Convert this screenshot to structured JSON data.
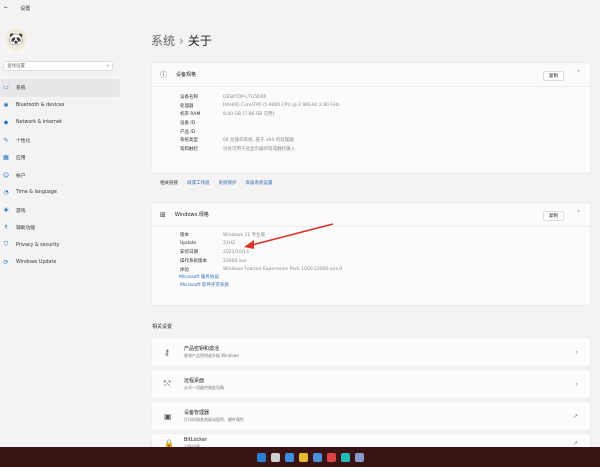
{
  "window": {
    "title": "设置",
    "back": "←"
  },
  "search": {
    "placeholder": "查找设置"
  },
  "sidebar": {
    "items": [
      {
        "label": "系统",
        "icon": "monitor-icon"
      },
      {
        "label": "Bluetooth & devices",
        "icon": "bluetooth-icon"
      },
      {
        "label": "Network & internet",
        "icon": "wifi-icon"
      },
      {
        "label": "个性化",
        "icon": "brush-icon"
      },
      {
        "label": "应用",
        "icon": "apps-icon"
      },
      {
        "label": "帐户",
        "icon": "person-icon"
      },
      {
        "label": "Time & language",
        "icon": "globe-clock-icon"
      },
      {
        "label": "游戏",
        "icon": "gamepad-icon"
      },
      {
        "label": "辅助功能",
        "icon": "accessibility-icon"
      },
      {
        "label": "Privacy & security",
        "icon": "shield-icon"
      },
      {
        "label": "Windows Update",
        "icon": "update-icon"
      }
    ]
  },
  "breadcrumb": {
    "parent": "系统",
    "sep": "›",
    "current": "关于"
  },
  "device_specs": {
    "title": "设备规格",
    "copy": "复制",
    "rows": [
      {
        "k": "设备名称",
        "v": "DESKTOP-L7G5D0R"
      },
      {
        "k": "处理器",
        "v": "Intel(R) Core(TM) i5-9400 CPU @ 2.90GHz   2.90 GHz"
      },
      {
        "k": "机带 RAM",
        "v": "8.00 GB (7.88 GB 可用)"
      },
      {
        "k": "设备 ID",
        "v": ""
      },
      {
        "k": "产品 ID",
        "v": ""
      },
      {
        "k": "系统类型",
        "v": "64 位操作系统, 基于 x64 的处理器"
      },
      {
        "k": "笔和触控",
        "v": "没有可用于此显示器的笔或触控输入"
      }
    ]
  },
  "related_links": {
    "label": "相关链接",
    "links": [
      "域或工作组",
      "系统保护",
      "高级系统设置"
    ]
  },
  "windows_specs": {
    "title": "Windows 规格",
    "copy": "复制",
    "rows": [
      {
        "k": "版本",
        "v": "Windows 11 专业版"
      },
      {
        "k": "Update",
        "v": "21H2"
      },
      {
        "k": "安装日期",
        "v": "2021/10/14"
      },
      {
        "k": "操作系统版本",
        "v": "22000.xxx"
      },
      {
        "k": "体验",
        "v": "Windows Feature Experience Pack 1000.22000.xxx.0"
      }
    ],
    "links": [
      "Microsoft 服务协议",
      "Microsoft 软件许可条款"
    ]
  },
  "related_settings": {
    "title": "相关设置",
    "items": [
      {
        "title": "产品密钥和激活",
        "sub": "更改产品密钥或升级 Windows",
        "icon": "key-icon",
        "action": "›"
      },
      {
        "title": "远程桌面",
        "sub": "从另一设备控制此设备",
        "icon": "remote-desktop-icon",
        "action": "›"
      },
      {
        "title": "设备管理器",
        "sub": "打印机和其他驱动程序、硬件属性",
        "icon": "device-manager-icon",
        "action": "↗"
      },
      {
        "title": "BitLocker",
        "sub": "设备加密",
        "icon": "bitlocker-icon",
        "action": "↗"
      }
    ]
  },
  "taskbar": {
    "icons": [
      "#2a7fd4",
      "#d0d0d0",
      "#3b8fe0",
      "#e8b830",
      "#4a90d9",
      "#d44",
      "#2bb",
      "#8899cc"
    ]
  }
}
